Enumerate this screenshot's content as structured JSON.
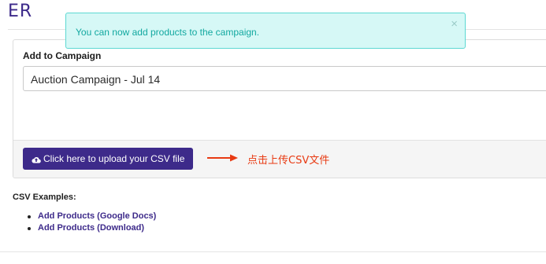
{
  "page": {
    "heading": "ER"
  },
  "alert": {
    "message": "You can now add products to the campaign.",
    "close_glyph": "×",
    "colors": {
      "background": "#d6f8f6",
      "border": "#5cd8d2",
      "text": "#12a8a0"
    }
  },
  "panel": {
    "label": "Add to Campaign",
    "campaign_select": {
      "value": "Auction Campaign - Jul 14"
    },
    "upload_button": {
      "label": "Click here to upload your CSV file",
      "icon": "cloud-upload-icon",
      "color": "#3d2a8a"
    },
    "annotation": {
      "text": "点击上传CSV文件",
      "icon": "arrow-right-icon",
      "color": "#e83a12"
    }
  },
  "examples": {
    "title": "CSV Examples:",
    "links": [
      {
        "label": "Add Products (Google Docs)"
      },
      {
        "label": "Add Products (Download)"
      }
    ]
  }
}
